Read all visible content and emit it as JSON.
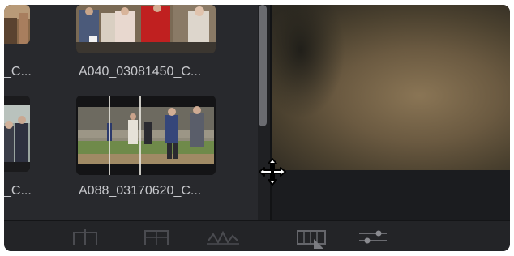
{
  "media_pool": {
    "clips": [
      {
        "id": "clip-top-left",
        "label": "_C..."
      },
      {
        "id": "clip-top-right",
        "label": "A040_03081450_C..."
      },
      {
        "id": "clip-bottom-left",
        "label": "_C..."
      },
      {
        "id": "clip-bottom-right",
        "label": "A088_03170620_C..."
      }
    ]
  },
  "toolbar": {
    "icons": [
      "clip-view-icon",
      "viewer-frame-icon",
      "waveform-icon",
      "timeline-grid-icon",
      "sliders-icon"
    ]
  },
  "cursor": {
    "type": "move-cursor-icon"
  },
  "colors": {
    "panel": "#28292d",
    "background": "#1e1f22",
    "label": "#c7c8cc"
  }
}
